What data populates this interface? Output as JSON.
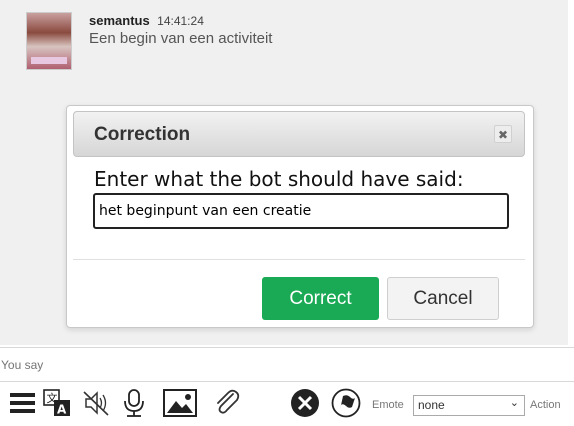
{
  "message": {
    "user": "semantus",
    "time": "14:41:24",
    "text": "Een begin van een activiteit"
  },
  "dialog": {
    "title": "Correction",
    "close_symbol": "✖",
    "prompt": "Enter what the bot should have said:",
    "input_value": "het beginpunt van een creatie",
    "correct_label": "Correct",
    "cancel_label": "Cancel"
  },
  "chat_input": {
    "placeholder": "You say"
  },
  "toolbar": {
    "icons": [
      "menu-icon",
      "translate-icon",
      "speaker-muted-icon",
      "microphone-icon",
      "image-icon",
      "paperclip-icon",
      "cancel-icon",
      "flag-icon"
    ],
    "emote_label": "Emote",
    "emote_value": "none",
    "action_label": "Action"
  },
  "colors": {
    "correct_button": "#1aaa55",
    "chat_background": "#f0f0f0"
  }
}
